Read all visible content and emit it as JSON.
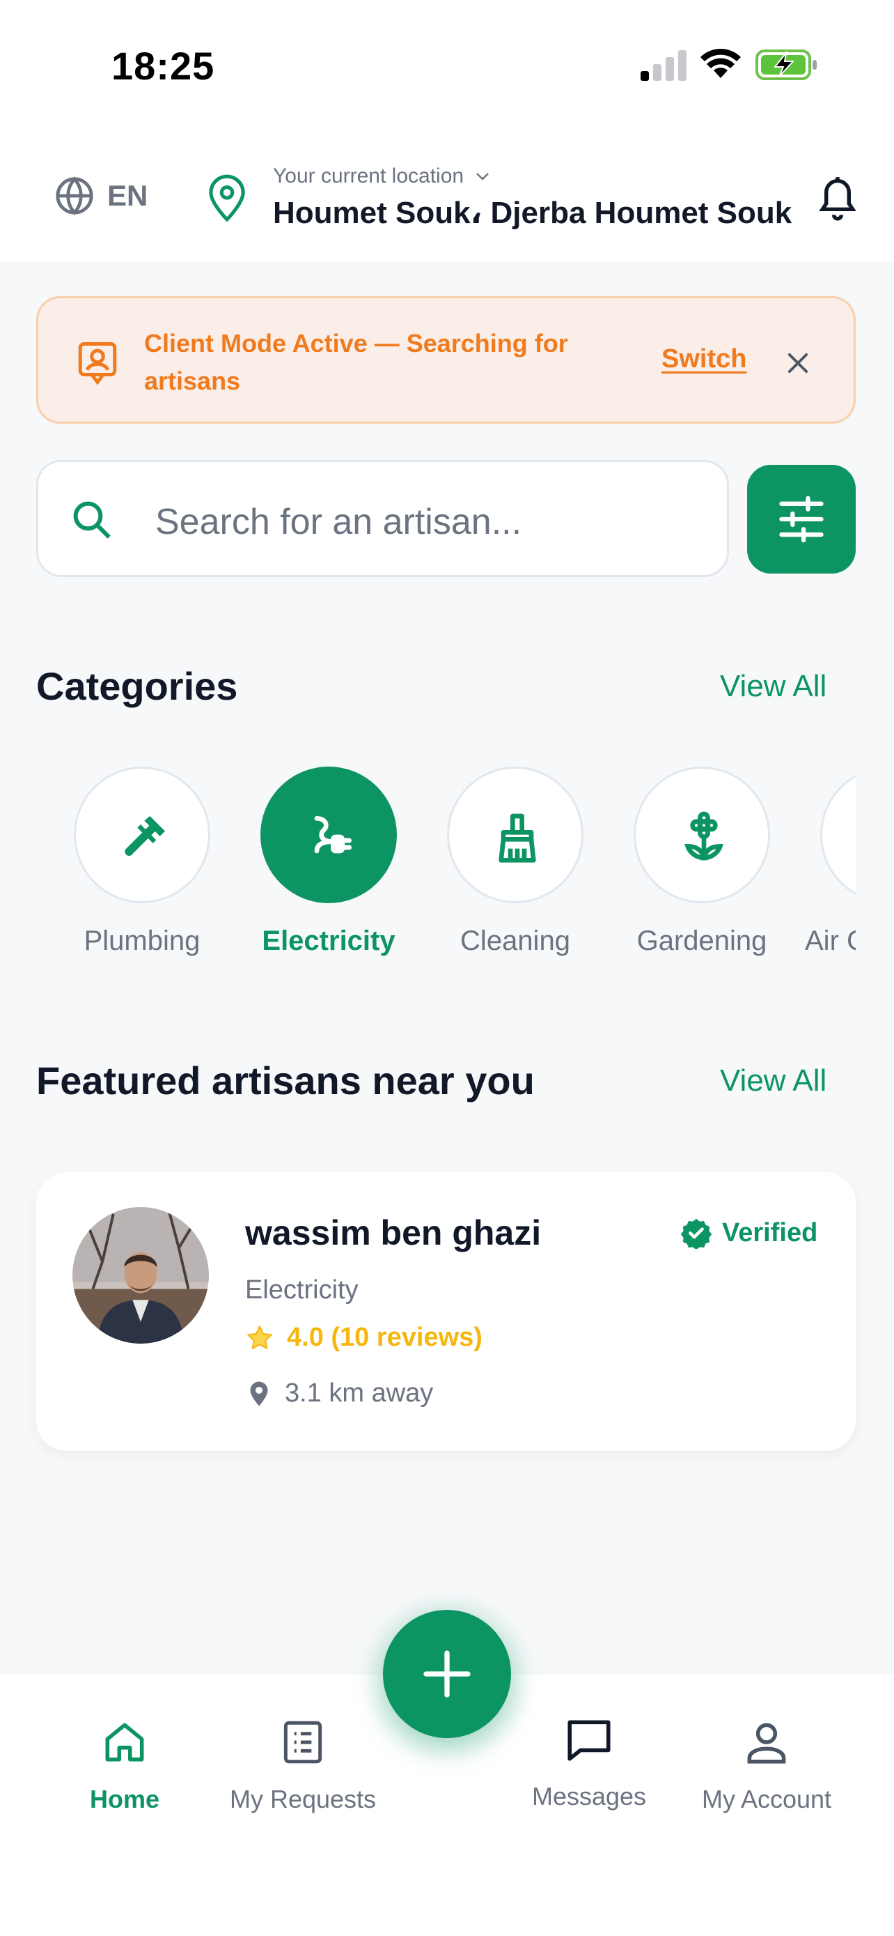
{
  "status_bar": {
    "time": "18:25"
  },
  "header": {
    "language": "EN",
    "location_caption": "Your current location",
    "location_name": "Houmet Souk، Djerba Houmet Souk"
  },
  "banner": {
    "text": "Client Mode Active — Searching for artisans",
    "switch_label": "Switch"
  },
  "search": {
    "placeholder": "Search for an artisan..."
  },
  "categories": {
    "title": "Categories",
    "view_all": "View All",
    "items": [
      {
        "label": "Plumbing",
        "icon": "wrench-icon",
        "active": false
      },
      {
        "label": "Electricity",
        "icon": "plug-icon",
        "active": true
      },
      {
        "label": "Cleaning",
        "icon": "broom-icon",
        "active": false
      },
      {
        "label": "Gardening",
        "icon": "flower-icon",
        "active": false
      },
      {
        "label": "Air Conditioning",
        "icon": "air-conditioning-icon",
        "active": false
      }
    ]
  },
  "featured": {
    "title": "Featured artisans near you",
    "view_all": "View All",
    "artisans": [
      {
        "name": "wassim ben ghazi",
        "badge": "Verified",
        "category": "Electricity",
        "rating": "4.0 (10 reviews)",
        "distance": "3.1 km away"
      }
    ]
  },
  "bottom_nav": {
    "items": [
      {
        "label": "Home",
        "icon": "home-icon",
        "active": true
      },
      {
        "label": "My Requests",
        "icon": "list-icon",
        "active": false
      },
      {
        "label": "Messages",
        "icon": "chat-icon",
        "active": false
      },
      {
        "label": "My Account",
        "icon": "user-icon",
        "active": false
      }
    ],
    "fab_icon": "plus-icon"
  },
  "colors": {
    "primary": "#0c9463",
    "accent_orange": "#f07a1e",
    "star": "#f5b70e",
    "text_dark": "#111827",
    "text_muted": "#6b7280"
  }
}
